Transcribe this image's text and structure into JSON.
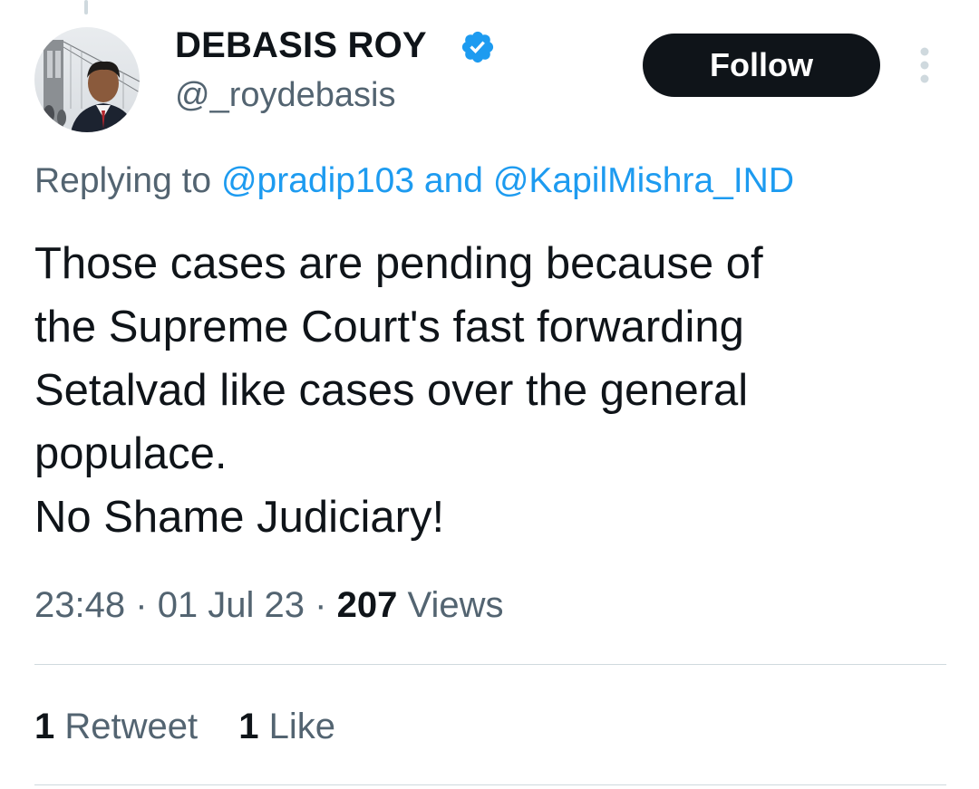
{
  "author": {
    "display_name": "DEBASIS ROY",
    "handle": "@_roydebasis",
    "verified": true,
    "avatar_icon": "profile-photo",
    "verified_icon": "verified-badge-icon",
    "verified_color": "#1d9bf0"
  },
  "follow_button": {
    "label": "Follow",
    "bg_color": "#0f1419",
    "text_color": "#ffffff"
  },
  "more_icon": "more-vertical-icon",
  "reply_context": {
    "prefix": "Replying to",
    "mentions": [
      "@pradip103",
      "@KapilMishra_IND"
    ],
    "separator": "and",
    "mention_color": "#1d9bf0"
  },
  "tweet": {
    "lines": [
      "Those cases are pending because of",
      "the Supreme Court's fast forwarding",
      "Setalvad like cases over the general",
      "populace.",
      "No Shame Judiciary!"
    ]
  },
  "meta": {
    "time": "23:48",
    "date": "01 Jul 23",
    "views_count": "207",
    "views_label": "Views",
    "dot": "·"
  },
  "stats": {
    "retweets_count": "1",
    "retweets_label": "Retweet",
    "likes_count": "1",
    "likes_label": "Like"
  }
}
